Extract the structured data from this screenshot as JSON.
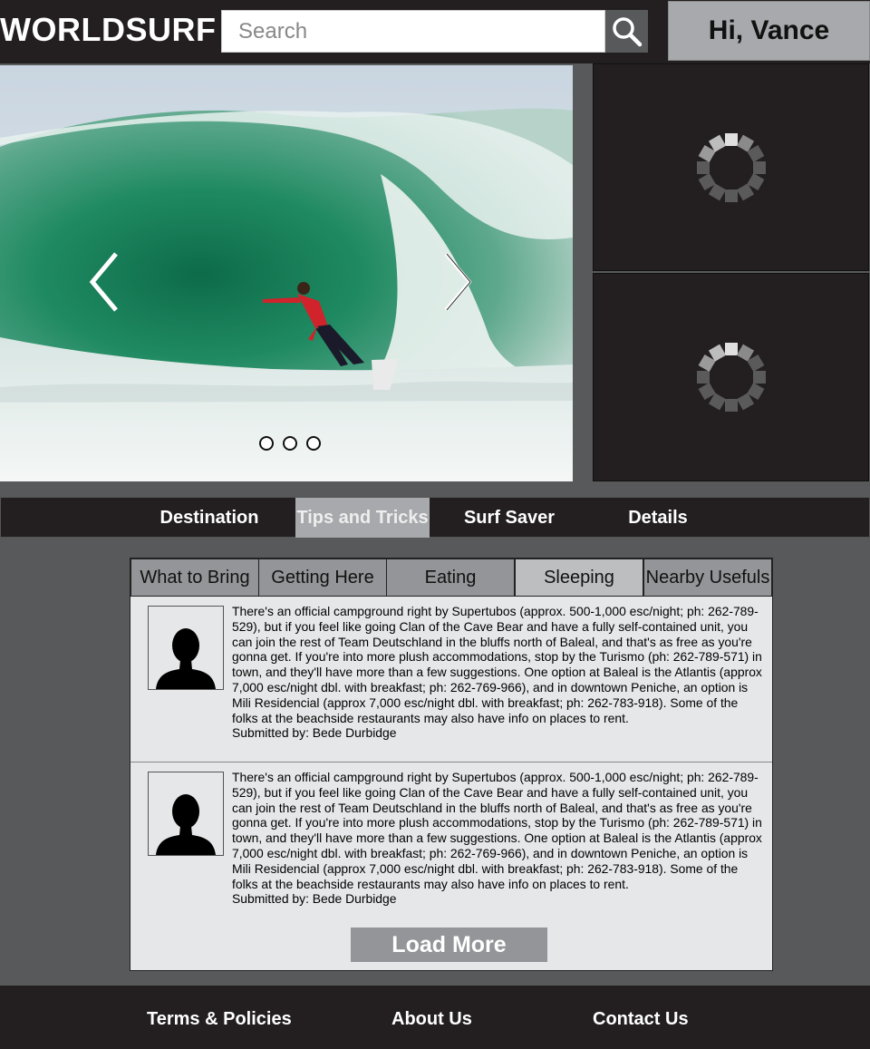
{
  "header": {
    "logo": "WORLDSURF",
    "search_placeholder": "Search",
    "greeting": "Hi, Vance"
  },
  "carousel": {
    "slide_count": 3
  },
  "nav": {
    "items": [
      {
        "label": "Destination"
      },
      {
        "label": "Tips and Tricks"
      },
      {
        "label": "Surf Saver"
      },
      {
        "label": "Details"
      }
    ],
    "active": "Tips and Tricks"
  },
  "subtabs": {
    "items": [
      {
        "label": "What to Bring"
      },
      {
        "label": "Getting Here"
      },
      {
        "label": "Eating"
      },
      {
        "label": "Sleeping"
      },
      {
        "label": "Nearby Usefuls"
      }
    ],
    "active": "Sleeping"
  },
  "posts": [
    {
      "text": "There's an official campground right by Supertubos (approx. 500-1,000 esc/night; ph: 262-789-529), but if you feel like going Clan of the Cave Bear and have a fully self-contained unit, you can join the rest of Team Deutschland in the bluffs north of Baleal, and that's as free as you're gonna get. If you're into more plush accommodations, stop by the Turismo (ph: 262-789-571) in town, and they'll have more than a few suggestions. One option at Baleal is the Atlantis (approx 7,000 esc/night dbl. with breakfast; ph: 262-769-966), and in downtown Peniche, an option is Mili Residencial (approx 7,000 esc/night dbl. with breakfast; ph: 262-783-918). Some of the folks at the beachside restaurants may also have info on places to rent.",
      "submitted_by": "Submitted by: Bede Durbidge"
    },
    {
      "text": "There's an official campground right by Supertubos (approx. 500-1,000 esc/night; ph: 262-789-529), but if you feel like going Clan of the Cave Bear and have a fully self-contained unit, you can join the rest of Team Deutschland in the bluffs north of Baleal, and that's as free as you're gonna get. If you're into more plush accommodations, stop by the Turismo (ph: 262-789-571) in town, and they'll have more than a few suggestions. One option at Baleal is the Atlantis (approx 7,000 esc/night dbl. with breakfast; ph: 262-769-966), and in downtown Peniche, an option is Mili Residencial (approx 7,000 esc/night dbl. with breakfast; ph: 262-783-918). Some of the folks at the beachside restaurants may also have info on places to rent.",
      "submitted_by": "Submitted by: Bede Durbidge"
    }
  ],
  "load_more_label": "Load More",
  "footer": {
    "links": [
      {
        "label": "Terms & Policies"
      },
      {
        "label": "About Us"
      },
      {
        "label": "Contact Us"
      }
    ]
  },
  "colors": {
    "dark": "#231f20",
    "mid_gray": "#58595b",
    "light_gray": "#a7a9ac",
    "panel_bg": "#e6e7e8"
  }
}
